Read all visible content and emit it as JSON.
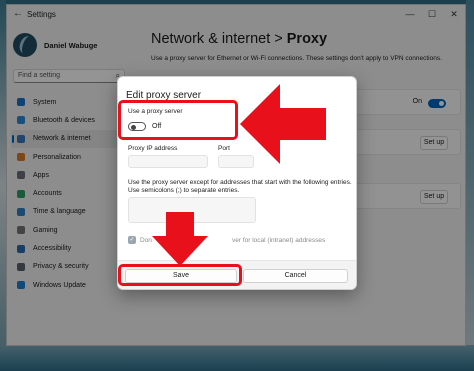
{
  "window": {
    "title": "Settings",
    "back_glyph": "←",
    "controls": [
      "—",
      "☐",
      "✕"
    ]
  },
  "user": {
    "name": "Daniel Wabuge"
  },
  "search": {
    "placeholder": "Find a setting",
    "icon": "search-icon"
  },
  "sidebar": {
    "items": [
      {
        "label": "System",
        "color": "#1a73c8",
        "active": false
      },
      {
        "label": "Bluetooth & devices",
        "color": "#2b88d8",
        "active": false
      },
      {
        "label": "Network & internet",
        "color": "#3a78b8",
        "active": true
      },
      {
        "label": "Personalization",
        "color": "#d97a2a",
        "active": false
      },
      {
        "label": "Apps",
        "color": "#6a6f7a",
        "active": false
      },
      {
        "label": "Accounts",
        "color": "#2f9d63",
        "active": false
      },
      {
        "label": "Time & language",
        "color": "#2f7fc4",
        "active": false
      },
      {
        "label": "Gaming",
        "color": "#767676",
        "active": false
      },
      {
        "label": "Accessibility",
        "color": "#2b6cb0",
        "active": false
      },
      {
        "label": "Privacy & security",
        "color": "#5a6270",
        "active": false
      },
      {
        "label": "Windows Update",
        "color": "#1e7fd0",
        "active": false
      }
    ]
  },
  "header": {
    "breadcrumb_parent": "Network & internet",
    "breadcrumb_sep": ">",
    "breadcrumb_current": "Proxy",
    "description": "Use a proxy server for Ethernet or Wi-Fi connections. These settings don't apply to VPN connections."
  },
  "background_cards": {
    "toggle_label": "On",
    "setup_label": "Set up"
  },
  "dialog": {
    "title": "Edit proxy server",
    "use_proxy_label": "Use a proxy server",
    "toggle_state": "Off",
    "ip_label": "Proxy IP address",
    "port_label": "Port",
    "exceptions_text_1": "Use the proxy server except for addresses that start with the following entries.",
    "exceptions_text_2": "Use semicolons (;) to separate entries.",
    "checkbox_text_left": "Don",
    "checkbox_text_right": "ver for local (intranet) addresses",
    "checkbox_glyph": "✓",
    "save_label": "Save",
    "cancel_label": "Cancel"
  },
  "annotations": {
    "highlight_color": "#e8101a"
  }
}
